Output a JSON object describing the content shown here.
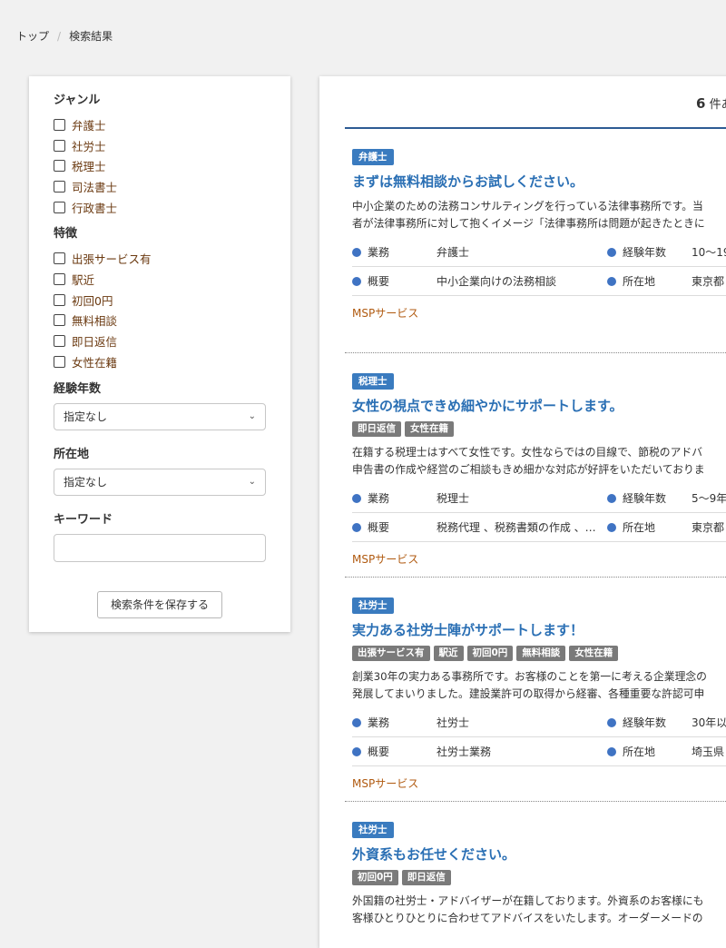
{
  "breadcrumb": {
    "home": "トップ",
    "separator": "/",
    "current": "検索結果"
  },
  "sidebar": {
    "genre": {
      "heading": "ジャンル",
      "options": [
        "弁護士",
        "社労士",
        "税理士",
        "司法書士",
        "行政書士"
      ]
    },
    "features": {
      "heading": "特徴",
      "options": [
        "出張サービス有",
        "駅近",
        "初回0円",
        "無料相談",
        "即日返信",
        "女性在籍"
      ]
    },
    "experience": {
      "heading": "経験年数",
      "selected": "指定なし"
    },
    "location": {
      "heading": "所在地",
      "selected": "指定なし"
    },
    "keyword": {
      "heading": "キーワード",
      "value": ""
    },
    "save_label": "検索条件を保存する"
  },
  "results": {
    "count_number": "6",
    "count_suffix": "件あ",
    "labels": {
      "business": "業務",
      "summary": "概要",
      "experience": "経験年数",
      "location": "所在地"
    },
    "cards": [
      {
        "category": "弁護士",
        "title": "まずは無料相談からお試しください。",
        "tags": [],
        "desc_line1": "中小企業のための法務コンサルティングを行っている法律事務所です。当",
        "desc_line2": "者が法律事務所に対して抱くイメージ「法律事務所は問題が起きたときに",
        "business": "弁護士",
        "summary": "中小企業向けの法務相談",
        "experience": "10〜19",
        "location": "東京都",
        "company": "MSPサービス"
      },
      {
        "category": "税理士",
        "title": "女性の視点できめ細やかにサポートします。",
        "tags": [
          "即日返信",
          "女性在籍"
        ],
        "desc_line1": "在籍する税理士はすべて女性です。女性ならではの目線で、節税のアドバ",
        "desc_line2": "申告書の作成や経営のご相談もきめ細かな対応が好評をいただいておりま",
        "business": "税理士",
        "summary": "税務代理 、税務書類の作成 、…",
        "experience": "5〜9年",
        "location": "東京都",
        "company": "MSPサービス"
      },
      {
        "category": "社労士",
        "title": "実力ある社労士陣がサポートします！",
        "tags": [
          "出張サービス有",
          "駅近",
          "初回0円",
          "無料相談",
          "女性在籍"
        ],
        "desc_line1": "創業30年の実力ある事務所です。お客様のことを第一に考える企業理念の",
        "desc_line2": "発展してまいりました。建設業許可の取得から経審、各種重要な許認可申",
        "business": "社労士",
        "summary": "社労士業務",
        "experience": "30年以",
        "location": "埼玉県",
        "company": "MSPサービス"
      },
      {
        "category": "社労士",
        "title": "外資系もお任せください。",
        "tags": [
          "初回0円",
          "即日返信"
        ],
        "desc_line1": "外国籍の社労士・アドバイザーが在籍しております。外資系のお客様にも",
        "desc_line2": "客様ひとりひとりに合わせてアドバイスをいたします。オーダーメードの"
      }
    ]
  },
  "colors": {
    "accent_blue": "#2a6fb4",
    "badge_blue": "#3a7bbf",
    "tag_gray": "#7a7a7a",
    "company_brown": "#b05a10",
    "checkbox_label_brown": "#6b3a11"
  }
}
